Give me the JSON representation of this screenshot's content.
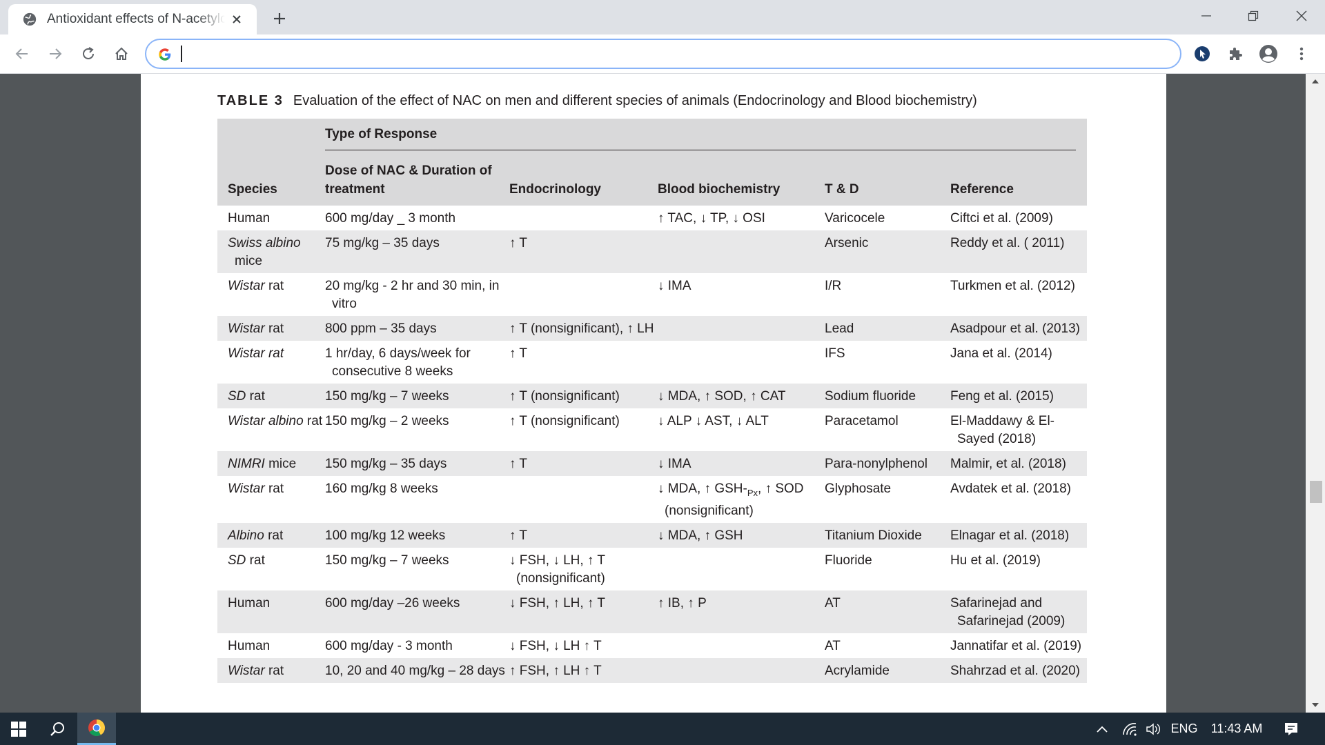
{
  "browser": {
    "tab_title": "Antioxidant effects of N-acetylcysteine",
    "address_value": "",
    "icons": [
      "globe-icon",
      "close-icon",
      "plus-icon",
      "minimize-icon",
      "restore-icon",
      "window-close-icon",
      "back-icon",
      "forward-icon",
      "reload-icon",
      "home-icon",
      "google-icon",
      "extension-blue-icon",
      "puzzle-icon",
      "profile-icon",
      "menu-icon"
    ]
  },
  "document": {
    "table_number": "TABLE 3",
    "table_caption": "Evaluation of the effect of NAC on men and different species of animals (Endocrinology and Blood biochemistry)",
    "headers": {
      "type_of_response": "Type of Response",
      "species": "Species",
      "dose": "Dose of NAC & Duration of treatment",
      "endocrinology": "Endocrinology",
      "blood_biochemistry": "Blood biochemistry",
      "t_and_d": "T & D",
      "reference": "Reference"
    },
    "rows": [
      {
        "species_italic": "",
        "species_plain": "Human",
        "dose": "600 mg/day _ 3 month",
        "endo": "",
        "bio": "↑ TAC, ↓ TP, ↓ OSI",
        "td": "Varicocele",
        "ref": "Ciftci et al. (2009)"
      },
      {
        "species_italic": "Swiss albino",
        "species_plain": " mice",
        "dose": "75 mg/kg – 35 days",
        "endo": "↑ T",
        "bio": "",
        "td": "Arsenic",
        "ref": "Reddy et al. ( 2011)"
      },
      {
        "species_italic": "Wistar",
        "species_plain": " rat",
        "dose": "20 mg/kg - 2 hr and 30 min, in vitro",
        "endo": "",
        "bio": "↓ IMA",
        "td": "I/R",
        "ref": "Turkmen et al. (2012)"
      },
      {
        "species_italic": "Wistar",
        "species_plain": " rat",
        "dose": "800 ppm – 35 days",
        "endo": "↑ T (nonsignificant), ↑ LH",
        "bio": "",
        "td": "Lead",
        "ref": "Asadpour et al. (2013)"
      },
      {
        "species_italic": "Wistar rat",
        "species_plain": "",
        "dose": "1 hr/day, 6 days/week for consecutive 8 weeks",
        "endo": "↑ T",
        "bio": "",
        "td": "IFS",
        "ref": "Jana et al. (2014)"
      },
      {
        "species_italic": "SD",
        "species_plain": " rat",
        "dose": "150 mg/kg – 7 weeks",
        "endo": "↑ T (nonsignificant)",
        "bio": "↓ MDA, ↑ SOD, ↑ CAT",
        "td": "Sodium fluoride",
        "ref": "Feng et al. (2015)"
      },
      {
        "species_italic": "Wistar albino",
        "species_plain": " rat",
        "dose": "150 mg/kg – 2 weeks",
        "endo": "↑ T (nonsignificant)",
        "bio": "↓ ALP ↓ AST, ↓ ALT",
        "td": "Paracetamol",
        "ref": "El-Maddawy & El-Sayed (2018)"
      },
      {
        "species_italic": "NIMRI",
        "species_plain": " mice",
        "dose": "150 mg/kg – 35 days",
        "endo": "↑ T",
        "bio": "↓ IMA",
        "td": "Para-nonylphenol",
        "ref": "Malmir, et al. (2018)"
      },
      {
        "species_italic": "Wistar",
        "species_plain": " rat",
        "dose": "160 mg/kg 8 weeks",
        "endo": "",
        "bio_pre": "↓ MDA, ↑ GSH-",
        "bio_sub": "Px",
        "bio_post": ", ↑ SOD (nonsignificant)",
        "td": "Glyphosate",
        "ref": "Avdatek et al. (2018)"
      },
      {
        "species_italic": "Albino",
        "species_plain": " rat",
        "dose": "100 mg/kg 12 weeks",
        "endo": "↑ T",
        "bio": "↓ MDA, ↑ GSH",
        "td": "Titanium Dioxide",
        "ref": "Elnagar et al. (2018)"
      },
      {
        "species_italic": "SD",
        "species_plain": " rat",
        "dose": "150 mg/kg – 7 weeks",
        "endo": "↓ FSH, ↓ LH, ↑ T (nonsignificant)",
        "bio": "",
        "td": "Fluoride",
        "ref": "Hu et al. (2019)"
      },
      {
        "species_italic": "",
        "species_plain": "Human",
        "dose": "600 mg/day –26 weeks",
        "endo": "↓ FSH, ↑ LH, ↑ T",
        "bio": "↑ IB, ↑ P",
        "td": "AT",
        "ref": "Safarinejad and Safarinejad (2009)"
      },
      {
        "species_italic": "",
        "species_plain": "Human",
        "dose": "600 mg/day - 3 month",
        "endo": "↓ FSH, ↓ LH ↑ T",
        "bio": "",
        "td": "AT",
        "ref": "Jannatifar et al. (2019)"
      },
      {
        "species_italic": "Wistar",
        "species_plain": " rat",
        "dose": "10, 20 and 40 mg/kg – 28 days",
        "endo": "↑ FSH, ↑ LH ↑ T",
        "bio": "",
        "td": "Acrylamide",
        "ref": "Shahrzad et al. (2020)"
      }
    ]
  },
  "taskbar": {
    "language": "ENG",
    "time": "11:43 AM"
  }
}
